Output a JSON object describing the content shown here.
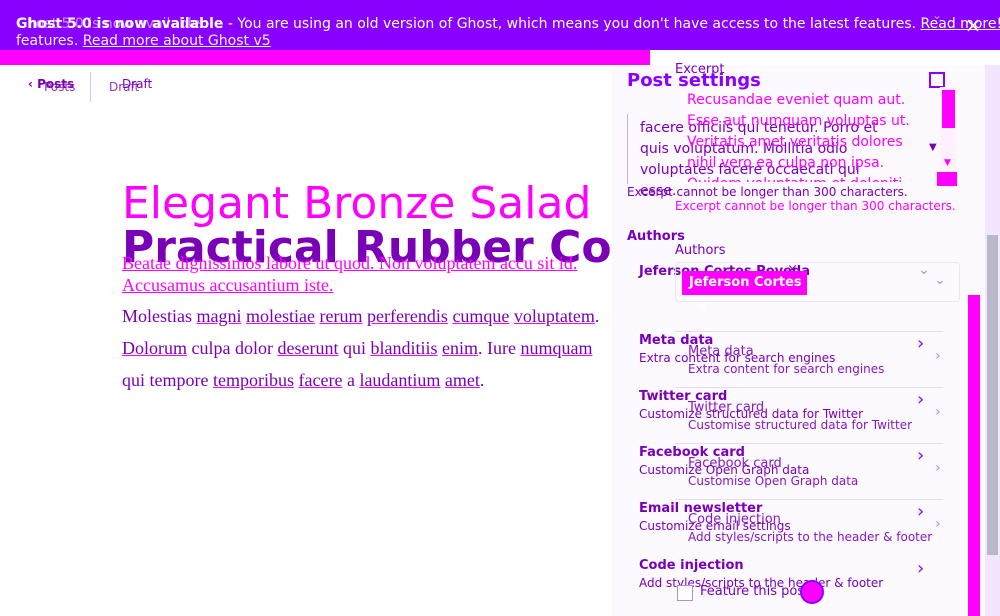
{
  "banner": {
    "line1_prefix": "Ghost 5.0 is now available",
    "line1_rest": " - You are using an old version of Ghost, which means you don't have access to the latest features. ",
    "line1_link": "Read more!",
    "line2_prefix": "features. ",
    "line2_link": "Read more about Ghost v5",
    "close_label": "×",
    "colors": {
      "bg": "#8a00ff",
      "accent": "#ff00ff"
    }
  },
  "header": {
    "back_label": "‹ Posts",
    "back_ghost": "Posts",
    "status_label": "Draft",
    "status_ghost": "Draft"
  },
  "editor": {
    "title_ghost": "Elegant Bronze Salad",
    "title": "Practical Rubber Com",
    "ghost_paragraph": "Beatae dignissimos labore ut quod. Non voluptatem accu sit id. Accusamus accusantium iste.",
    "paragraph_words": [
      {
        "t": "Molestias ",
        "u": false
      },
      {
        "t": "magni",
        "u": true
      },
      {
        "t": " ",
        "u": false
      },
      {
        "t": "molestiae",
        "u": true
      },
      {
        "t": " ",
        "u": false
      },
      {
        "t": "rerum",
        "u": true
      },
      {
        "t": " ",
        "u": false
      },
      {
        "t": "perferendis",
        "u": true
      },
      {
        "t": " ",
        "u": false
      },
      {
        "t": "cumque",
        "u": true
      },
      {
        "t": " ",
        "u": false
      },
      {
        "t": "voluptatem",
        "u": true
      },
      {
        "t": ". ",
        "u": false
      },
      {
        "t": "Dolorum",
        "u": true
      },
      {
        "t": " culpa dolor ",
        "u": false
      },
      {
        "t": "deserunt",
        "u": true
      },
      {
        "t": " qui ",
        "u": false
      },
      {
        "t": "blanditiis",
        "u": true
      },
      {
        "t": " ",
        "u": false
      },
      {
        "t": "enim",
        "u": true
      },
      {
        "t": ". Iure ",
        "u": false
      },
      {
        "t": "numquam",
        "u": true
      },
      {
        "t": " qui tempore ",
        "u": false
      },
      {
        "t": "temporibus",
        "u": true
      },
      {
        "t": " ",
        "u": false
      },
      {
        "t": "facere",
        "u": true
      },
      {
        "t": " a ",
        "u": false
      },
      {
        "t": "laudantium",
        "u": true
      },
      {
        "t": " ",
        "u": false
      },
      {
        "t": "amet",
        "u": true
      },
      {
        "t": ".",
        "u": false
      }
    ]
  },
  "sidebar": {
    "title": "Post settings",
    "excerpt": {
      "label": "Excerpt",
      "text_a": "facere officiis qui tenetur. Porro et quis voluptatum. Mollitia odio voluptates facere occaecati qui esse.",
      "text_b": "Recusandae eveniet quam aut. Esse aut numquam voluptas ut. Veritatis amet veritatis dolores nihil vero ea culpa non ipsa. Quidem voluptatum et deleniti sequi non.",
      "error": "Excerpt cannot be longer than 300 characters.",
      "error_ghost": "Excerpt cannot be longer than 300 characters."
    },
    "authors": {
      "label": "Authors",
      "label_ghost": "Authors",
      "value_ghost": "Jeferson Cortes Poveda",
      "chip": "Jeferson Cortes",
      "chip_remove": "×"
    },
    "cards": [
      {
        "title": "Meta data",
        "sub": "Extra content for search engines",
        "title_ghost": "Meta data",
        "sub_ghost": "Extra content for search engines"
      },
      {
        "title": "Twitter card",
        "sub": "Customize structured data for Twitter",
        "title_ghost": "Twitter card",
        "sub_ghost": "Customise structured data for Twitter"
      },
      {
        "title": "Facebook card",
        "sub": "Customize Open Graph data",
        "title_ghost": "Facebook card",
        "sub_ghost": "Customise Open Graph data"
      },
      {
        "title": "Email newsletter",
        "sub": "Customize email settings",
        "title_ghost": "Code injection",
        "sub_ghost": "Add styles/scripts to the header & footer"
      },
      {
        "title": "Code injection",
        "sub": "Add styles/scripts to the header & footer"
      }
    ],
    "feature_label": "Feature this post"
  }
}
